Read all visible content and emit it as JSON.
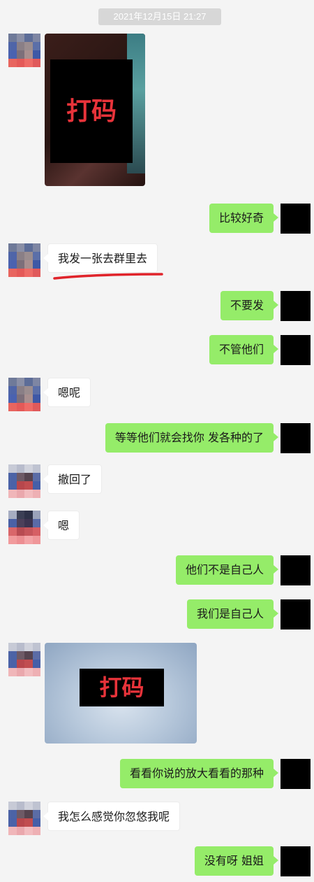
{
  "timestamp": "2021年12月15日 21:27",
  "censor_label": "打码",
  "messages": {
    "m2": "比较好奇",
    "m3": "我发一张去群里去",
    "m4": "不要发",
    "m5": "不管他们",
    "m6": "嗯呢",
    "m7": "等等他们就会找你 发各种的了",
    "m8": "撤回了",
    "m9": "嗯",
    "m10": "他们不是自己人",
    "m11": "我们是自己人",
    "m13": "看看你说的放大看看的那种",
    "m14": "我怎么感觉你忽悠我呢",
    "m15": "没有呀 姐姐"
  },
  "colors": {
    "background": "#f4f4f4",
    "sent_bubble": "#95ec69",
    "received_bubble": "#ffffff",
    "censor_text": "#e8333a",
    "underline": "#e0242b"
  }
}
